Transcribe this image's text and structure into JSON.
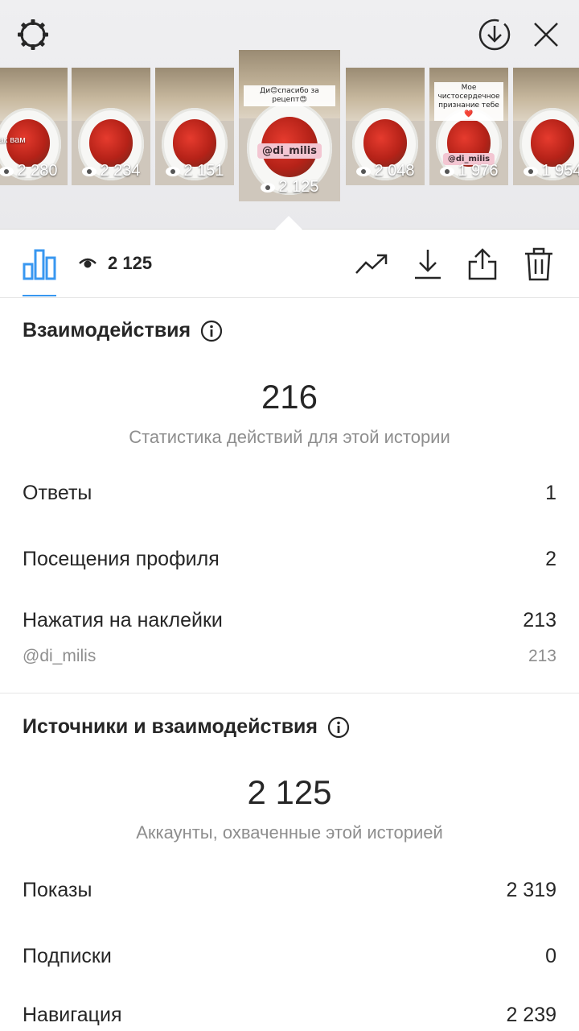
{
  "thumbnails": [
    {
      "views": "2 280",
      "overlay_text": "Как вам",
      "selected": false
    },
    {
      "views": "2 234",
      "selected": false
    },
    {
      "views": "2 151",
      "selected": false
    },
    {
      "views": "2 125",
      "caption": "Ди😊спасибо за рецепт😍",
      "mention": "@di_milis",
      "selected": true
    },
    {
      "views": "2 048",
      "selected": false
    },
    {
      "views": "1 976",
      "caption": "Мое чистосердечное признание тебе❤️",
      "mention": "@di_milis",
      "selected": false
    },
    {
      "views": "1 954",
      "selected": false
    }
  ],
  "toolbar": {
    "view_count": "2 125"
  },
  "interactions": {
    "title": "Взаимодействия",
    "total": "216",
    "total_label": "Статистика действий для этой истории",
    "rows": [
      {
        "label": "Ответы",
        "value": "1"
      },
      {
        "label": "Посещения профиля",
        "value": "2"
      },
      {
        "label": "Нажатия на наклейки",
        "value": "213"
      }
    ],
    "sticker_sub": {
      "label": "@di_milis",
      "value": "213"
    }
  },
  "discovery": {
    "title": "Источники и взаимодействия",
    "total": "2 125",
    "total_label": "Аккаунты, охваченные этой историей",
    "rows": [
      {
        "label": "Показы",
        "value": "2 319"
      },
      {
        "label": "Подписки",
        "value": "0"
      },
      {
        "label": "Навигация",
        "value": "2 239"
      }
    ]
  },
  "colors": {
    "accent": "#3897f0",
    "text": "#262626",
    "muted": "#8e8e8e"
  },
  "icons": [
    "gear-icon",
    "download-circle-icon",
    "close-icon",
    "bar-chart-icon",
    "eye-icon",
    "trend-icon",
    "download-icon",
    "share-icon",
    "trash-icon",
    "info-icon"
  ]
}
